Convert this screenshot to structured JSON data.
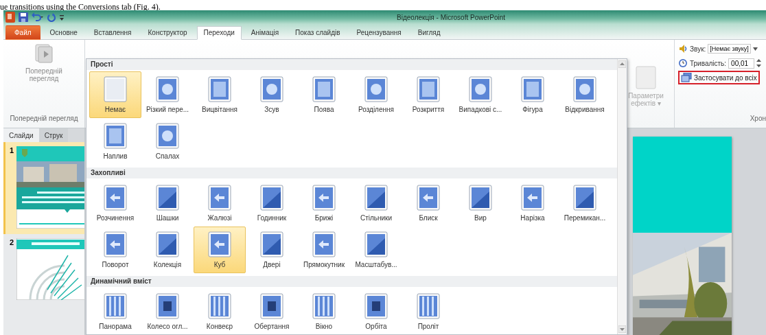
{
  "caption": "ue transitions using the Conversions tab (Fig. 4).",
  "window": {
    "title": "Відеолекція - Microsoft PowerPoint"
  },
  "tabs": [
    {
      "label": "Файл",
      "kind": "file",
      "selected": false
    },
    {
      "label": "Основне",
      "kind": "tab",
      "selected": false
    },
    {
      "label": "Вставлення",
      "kind": "tab",
      "selected": false
    },
    {
      "label": "Конструктор",
      "kind": "tab",
      "selected": false
    },
    {
      "label": "Переходи",
      "kind": "tab",
      "selected": true
    },
    {
      "label": "Анімація",
      "kind": "tab",
      "selected": false
    },
    {
      "label": "Показ слайдів",
      "kind": "tab",
      "selected": false
    },
    {
      "label": "Рецензування",
      "kind": "tab",
      "selected": false
    },
    {
      "label": "Вигляд",
      "kind": "tab",
      "selected": false
    }
  ],
  "ribbon": {
    "preview": {
      "label": "Попередній перегляд",
      "group": "Попередній перегляд",
      "disabled": true
    },
    "effects": {
      "label": "Параметри ефектів",
      "arrow": "▾",
      "disabled": true
    },
    "sound": {
      "label": "Звук:",
      "value": "[Немає звуку]"
    },
    "duration": {
      "label": "Тривалість:",
      "value": "00,01"
    },
    "apply_all": {
      "label": "Застосувати до всіх",
      "outlined": true
    },
    "timing_group": "Хрон"
  },
  "slide_panel": {
    "tabs": [
      {
        "label": "Слайди",
        "selected": true
      },
      {
        "label": "Струк",
        "selected": false
      }
    ],
    "slides": [
      {
        "number": "1",
        "kind": "title",
        "selected": true
      },
      {
        "number": "2",
        "kind": "diagram",
        "selected": false
      }
    ]
  },
  "gallery": {
    "sections": [
      {
        "title": "Прості",
        "items": [
          {
            "label": "Немає",
            "selected": true
          },
          {
            "label": "Різкий пере...",
            "selected": false
          },
          {
            "label": "Вицвітання",
            "selected": false
          },
          {
            "label": "Зсув",
            "selected": false
          },
          {
            "label": "Поява",
            "selected": false
          },
          {
            "label": "Розділення",
            "selected": false
          },
          {
            "label": "Розкриття",
            "selected": false
          },
          {
            "label": "Випадкові с...",
            "selected": false
          },
          {
            "label": "Фігура",
            "selected": false
          },
          {
            "label": "Відкривання",
            "selected": false
          },
          {
            "label": "Наплив",
            "selected": false
          },
          {
            "label": "Спалах",
            "selected": false
          }
        ]
      },
      {
        "title": "Захопливі",
        "items": [
          {
            "label": "Розчинення",
            "selected": false
          },
          {
            "label": "Шашки",
            "selected": false
          },
          {
            "label": "Жалюзі",
            "selected": false
          },
          {
            "label": "Годинник",
            "selected": false
          },
          {
            "label": "Брижі",
            "selected": false
          },
          {
            "label": "Стільники",
            "selected": false
          },
          {
            "label": "Блиск",
            "selected": false
          },
          {
            "label": "Вир",
            "selected": false
          },
          {
            "label": "Нарізка",
            "selected": false
          },
          {
            "label": "Перемикан...",
            "selected": false
          },
          {
            "label": "Поворот",
            "selected": false
          },
          {
            "label": "Колекція",
            "selected": false
          },
          {
            "label": "Куб",
            "selected": true
          },
          {
            "label": "Двері",
            "selected": false
          },
          {
            "label": "Прямокутник",
            "selected": false
          },
          {
            "label": "Масштабув...",
            "selected": false
          }
        ]
      },
      {
        "title": "Динамічний вміст",
        "items": [
          {
            "label": "Панорама",
            "selected": false
          },
          {
            "label": "Колесо огл...",
            "selected": false
          },
          {
            "label": "Конвеєр",
            "selected": false
          },
          {
            "label": "Обертання",
            "selected": false
          },
          {
            "label": "Вікно",
            "selected": false
          },
          {
            "label": "Орбіта",
            "selected": false
          },
          {
            "label": "Проліт",
            "selected": false
          }
        ]
      }
    ]
  }
}
